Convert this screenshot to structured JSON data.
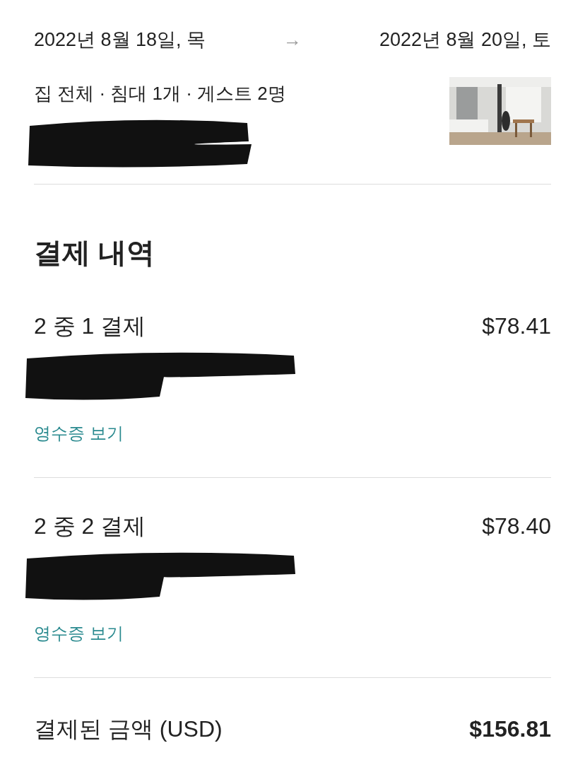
{
  "dates": {
    "check_in": "2022년 8월 18일, 목",
    "arrow": "→",
    "check_out": "2022년 8월 20일, 토"
  },
  "listing": {
    "summary": "집 전체 · 침대 1개 · 게스트 2명",
    "confirmation_redacted": true
  },
  "payments": {
    "heading": "결제 내역",
    "items": [
      {
        "title": "2 중 1 결제",
        "amount": "$78.41",
        "redacted": true,
        "link": "영수증 보기"
      },
      {
        "title": "2 중 2 결제",
        "amount": "$78.40",
        "redacted": true,
        "link": "영수증 보기"
      }
    ]
  },
  "total": {
    "label": "결제된 금액 (USD)",
    "amount": "$156.81"
  }
}
